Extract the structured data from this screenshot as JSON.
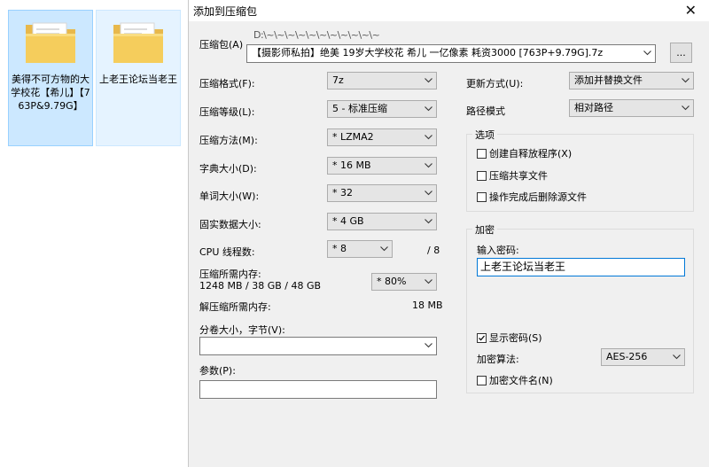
{
  "explorer": {
    "items": [
      {
        "label": "美得不可方物的大学校花【希儿】【763P&9.79G】",
        "selected": true
      },
      {
        "label": "上老王论坛当老王",
        "selected": false
      }
    ]
  },
  "dialog": {
    "title": "添加到压缩包",
    "close_glyph": "✕",
    "archive": {
      "label": "压缩包(A)",
      "path_garbled": "D:\\~\\~\\~\\~\\~\\~\\~\\~\\~\\~\\~",
      "filename": "【摄影师私拍】绝美 19岁大学校花 希儿 一亿像素 耗资3000 [763P+9.79G].7z",
      "browse_label": "..."
    },
    "left": {
      "format": {
        "label": "压缩格式(F):",
        "value": "7z"
      },
      "level": {
        "label": "压缩等级(L):",
        "value": "5 - 标准压缩"
      },
      "method": {
        "label": "压缩方法(M):",
        "value": "* LZMA2"
      },
      "dict": {
        "label": "字典大小(D):",
        "value": "* 16 MB"
      },
      "word": {
        "label": "单词大小(W):",
        "value": "* 32"
      },
      "solid": {
        "label": "固实数据大小:",
        "value": "* 4 GB"
      },
      "threads": {
        "label": "CPU 线程数:",
        "value": "* 8",
        "max": "/ 8"
      },
      "mem_compress": {
        "label": "压缩所需内存:",
        "detail": "1248 MB / 38 GB / 48 GB",
        "value": "* 80%"
      },
      "mem_decompress": {
        "label": "解压缩所需内存:",
        "value": "18 MB"
      },
      "split": {
        "label": "分卷大小，字节(V):",
        "value": ""
      },
      "params": {
        "label": "参数(P):",
        "value": ""
      }
    },
    "right": {
      "update": {
        "label": "更新方式(U):",
        "value": "添加并替换文件"
      },
      "path_mode": {
        "label": "路径模式",
        "value": "相对路径"
      },
      "options": {
        "title": "选项",
        "sfx": {
          "label": "创建自释放程序(X)",
          "checked": false
        },
        "shared": {
          "label": "压缩共享文件",
          "checked": false
        },
        "delete_after": {
          "label": "操作完成后删除源文件",
          "checked": false
        }
      },
      "encryption": {
        "title": "加密",
        "password_label": "输入密码:",
        "password_value": "上老王论坛当老王",
        "show_password": {
          "label": "显示密码(S)",
          "checked": true
        },
        "method_label": "加密算法:",
        "method_value": "AES-256",
        "encrypt_names": {
          "label": "加密文件名(N)",
          "checked": false
        }
      }
    }
  }
}
